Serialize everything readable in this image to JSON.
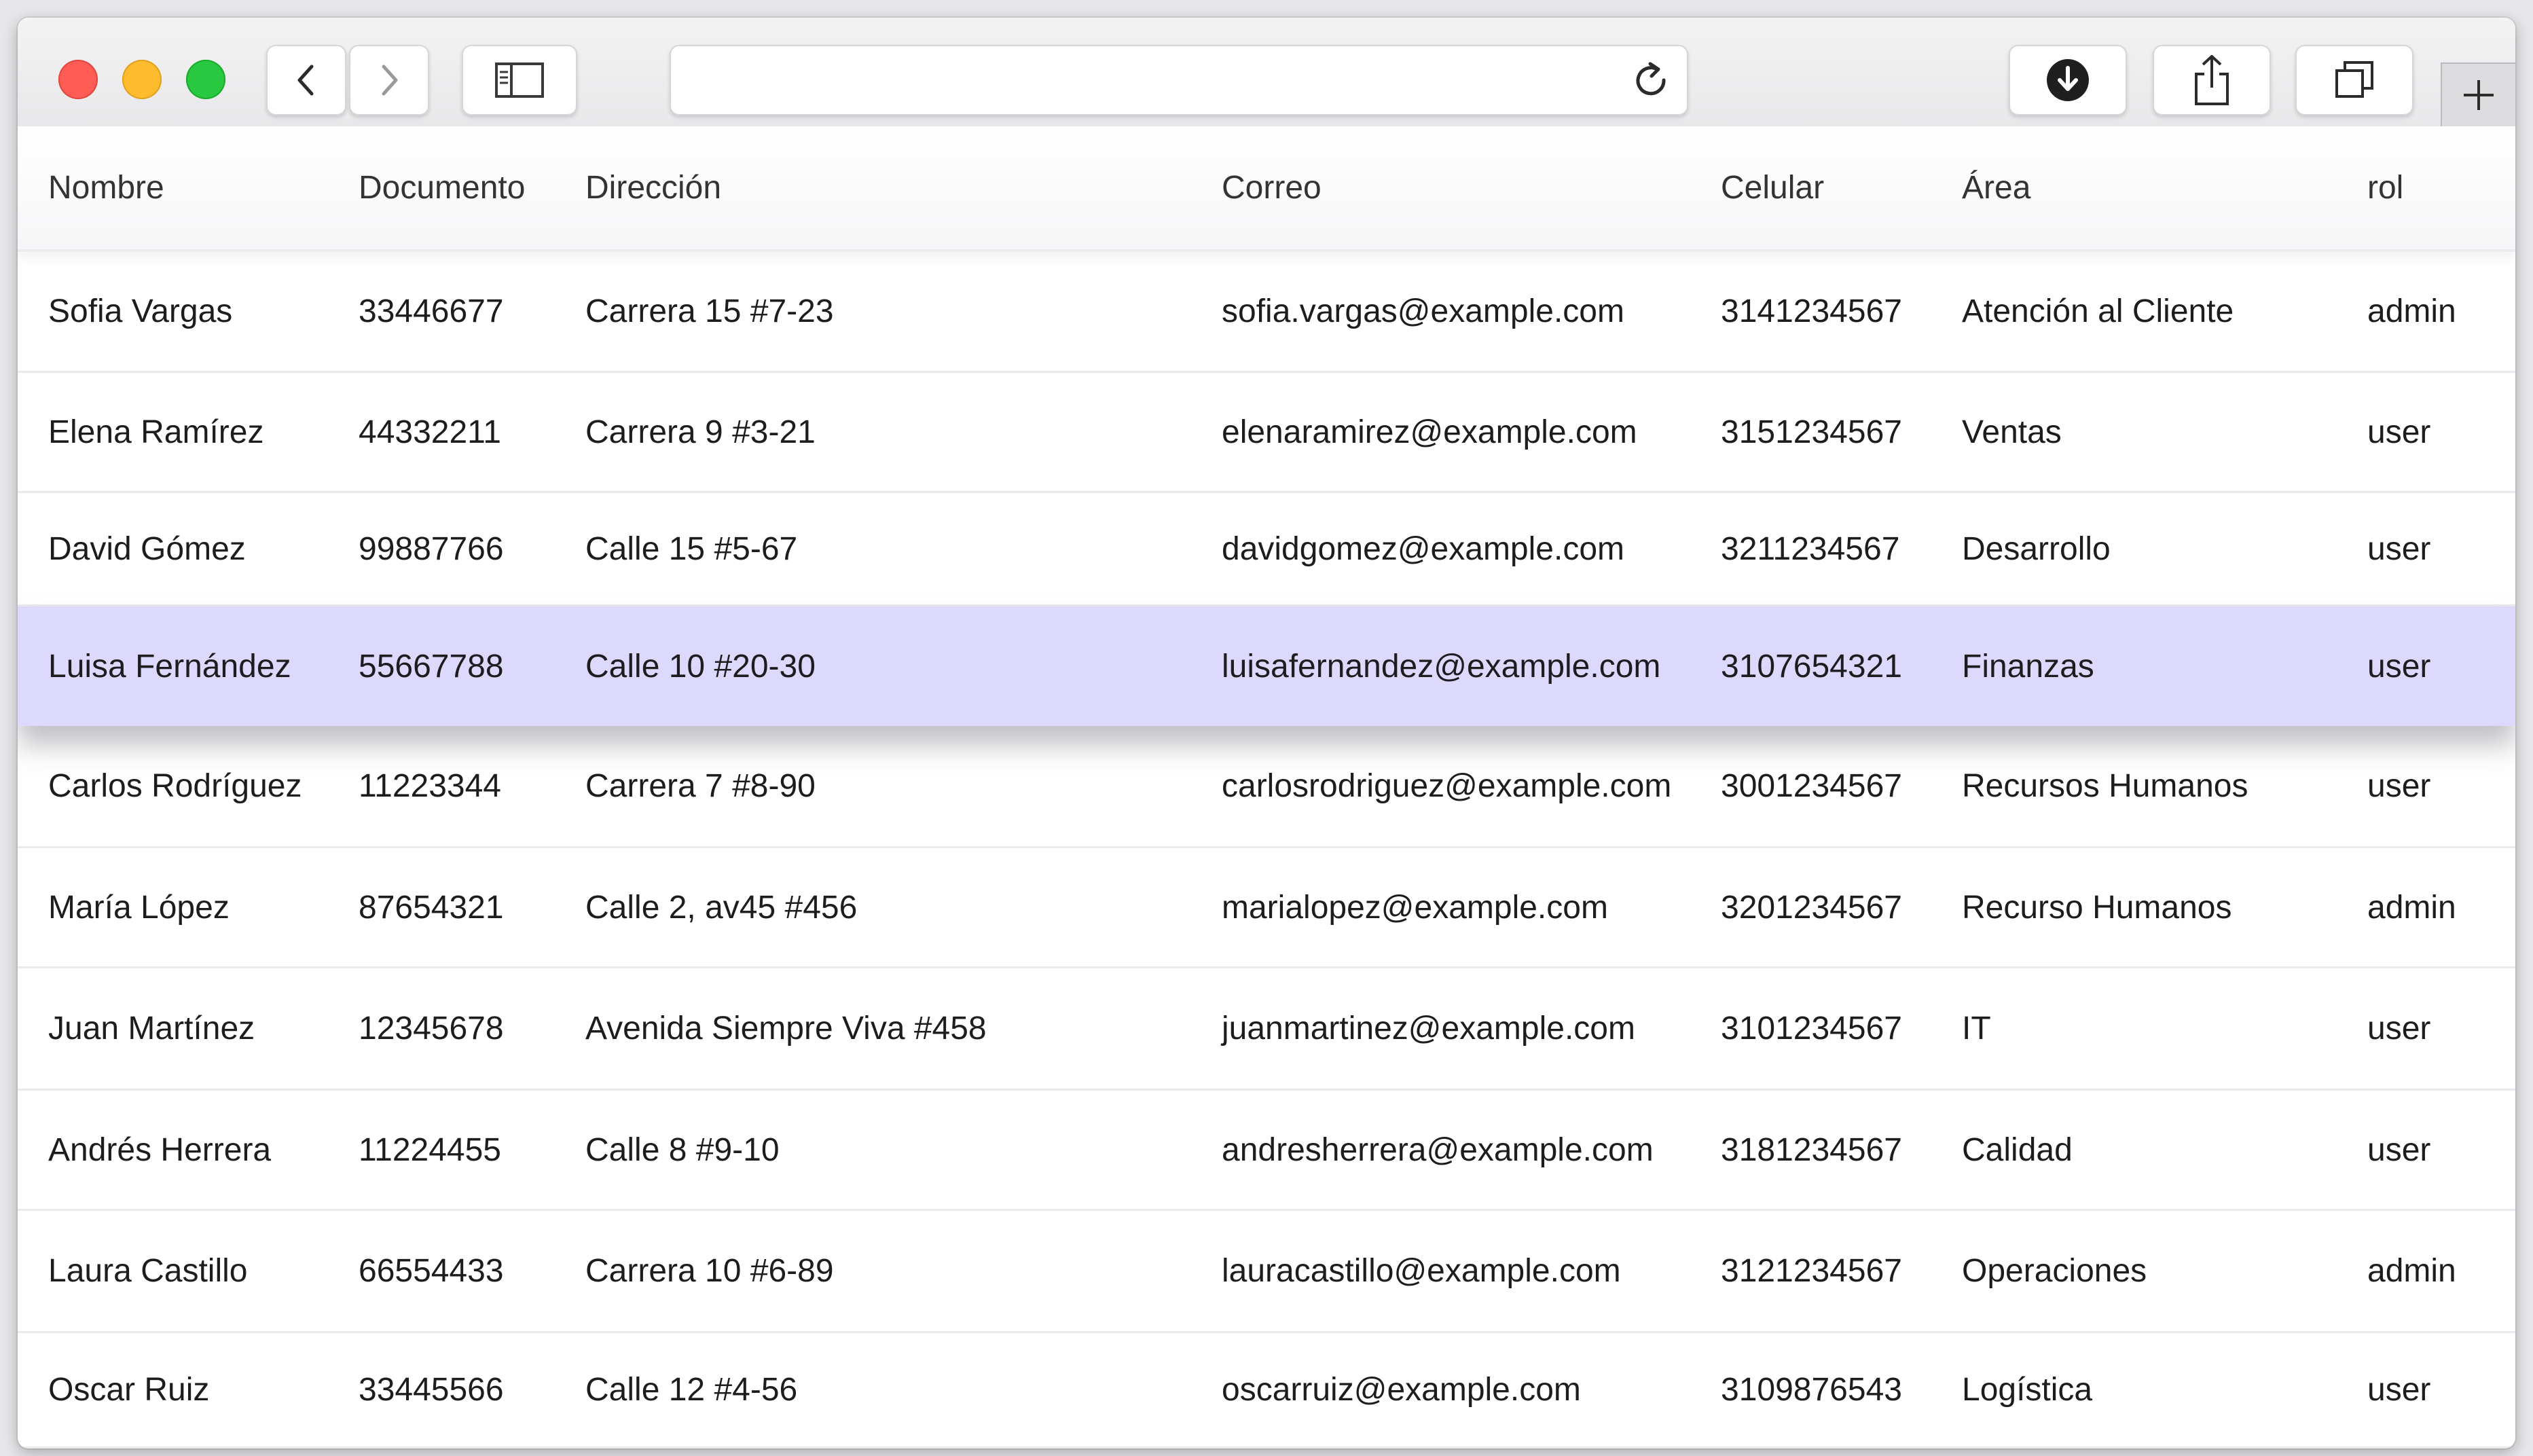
{
  "window": {
    "url": "",
    "colors": {
      "highlight_row": "#ddd9fd",
      "close": "#fe5c55",
      "minimize": "#fdbb2d",
      "zoom": "#28c840"
    }
  },
  "toolbar": {
    "icons": [
      "chevron-left-icon",
      "chevron-right-icon",
      "sidebar-icon",
      "reload-icon",
      "download-icon",
      "share-icon",
      "tabs-icon",
      "plus-icon"
    ]
  },
  "table": {
    "columns": [
      "Nombre",
      "Documento",
      "Dirección",
      "Correo",
      "Celular",
      "Área",
      "rol"
    ],
    "rows": [
      [
        "Sofia Vargas",
        "33446677",
        "Carrera 15 #7-23",
        "sofia.vargas@example.com",
        "3141234567",
        "Atención al Cliente",
        "admin"
      ],
      [
        "Elena Ramírez",
        "44332211",
        "Carrera 9 #3-21",
        "elenaramirez@example.com",
        "3151234567",
        "Ventas",
        "user"
      ],
      [
        "David Gómez",
        "99887766",
        "Calle 15 #5-67",
        "davidgomez@example.com",
        "3211234567",
        "Desarrollo",
        "user"
      ],
      [
        "Luisa Fernández",
        "55667788",
        "Calle 10 #20-30",
        "luisafernandez@example.com",
        "3107654321",
        "Finanzas",
        "user"
      ],
      [
        "Carlos Rodríguez",
        "11223344",
        "Carrera 7 #8-90",
        "carlosrodriguez@example.com",
        "3001234567",
        "Recursos Humanos",
        "user"
      ],
      [
        "María López",
        "87654321",
        "Calle 2, av45 #456",
        "marialopez@example.com",
        "3201234567",
        "Recurso Humanos",
        "admin"
      ],
      [
        "Juan Martínez",
        "12345678",
        "Avenida Siempre Viva #458",
        "juanmartinez@example.com",
        "3101234567",
        "IT",
        "user"
      ],
      [
        "Andrés Herrera",
        "11224455",
        "Calle 8 #9-10",
        "andresherrera@example.com",
        "3181234567",
        "Calidad",
        "user"
      ],
      [
        "Laura Castillo",
        "66554433",
        "Carrera 10 #6-89",
        "lauracastillo@example.com",
        "3121234567",
        "Operaciones",
        "admin"
      ],
      [
        "Oscar Ruiz",
        "33445566",
        "Calle 12 #4-56",
        "oscarruiz@example.com",
        "3109876543",
        "Logística",
        "user"
      ]
    ],
    "highlighted_row": 3
  }
}
